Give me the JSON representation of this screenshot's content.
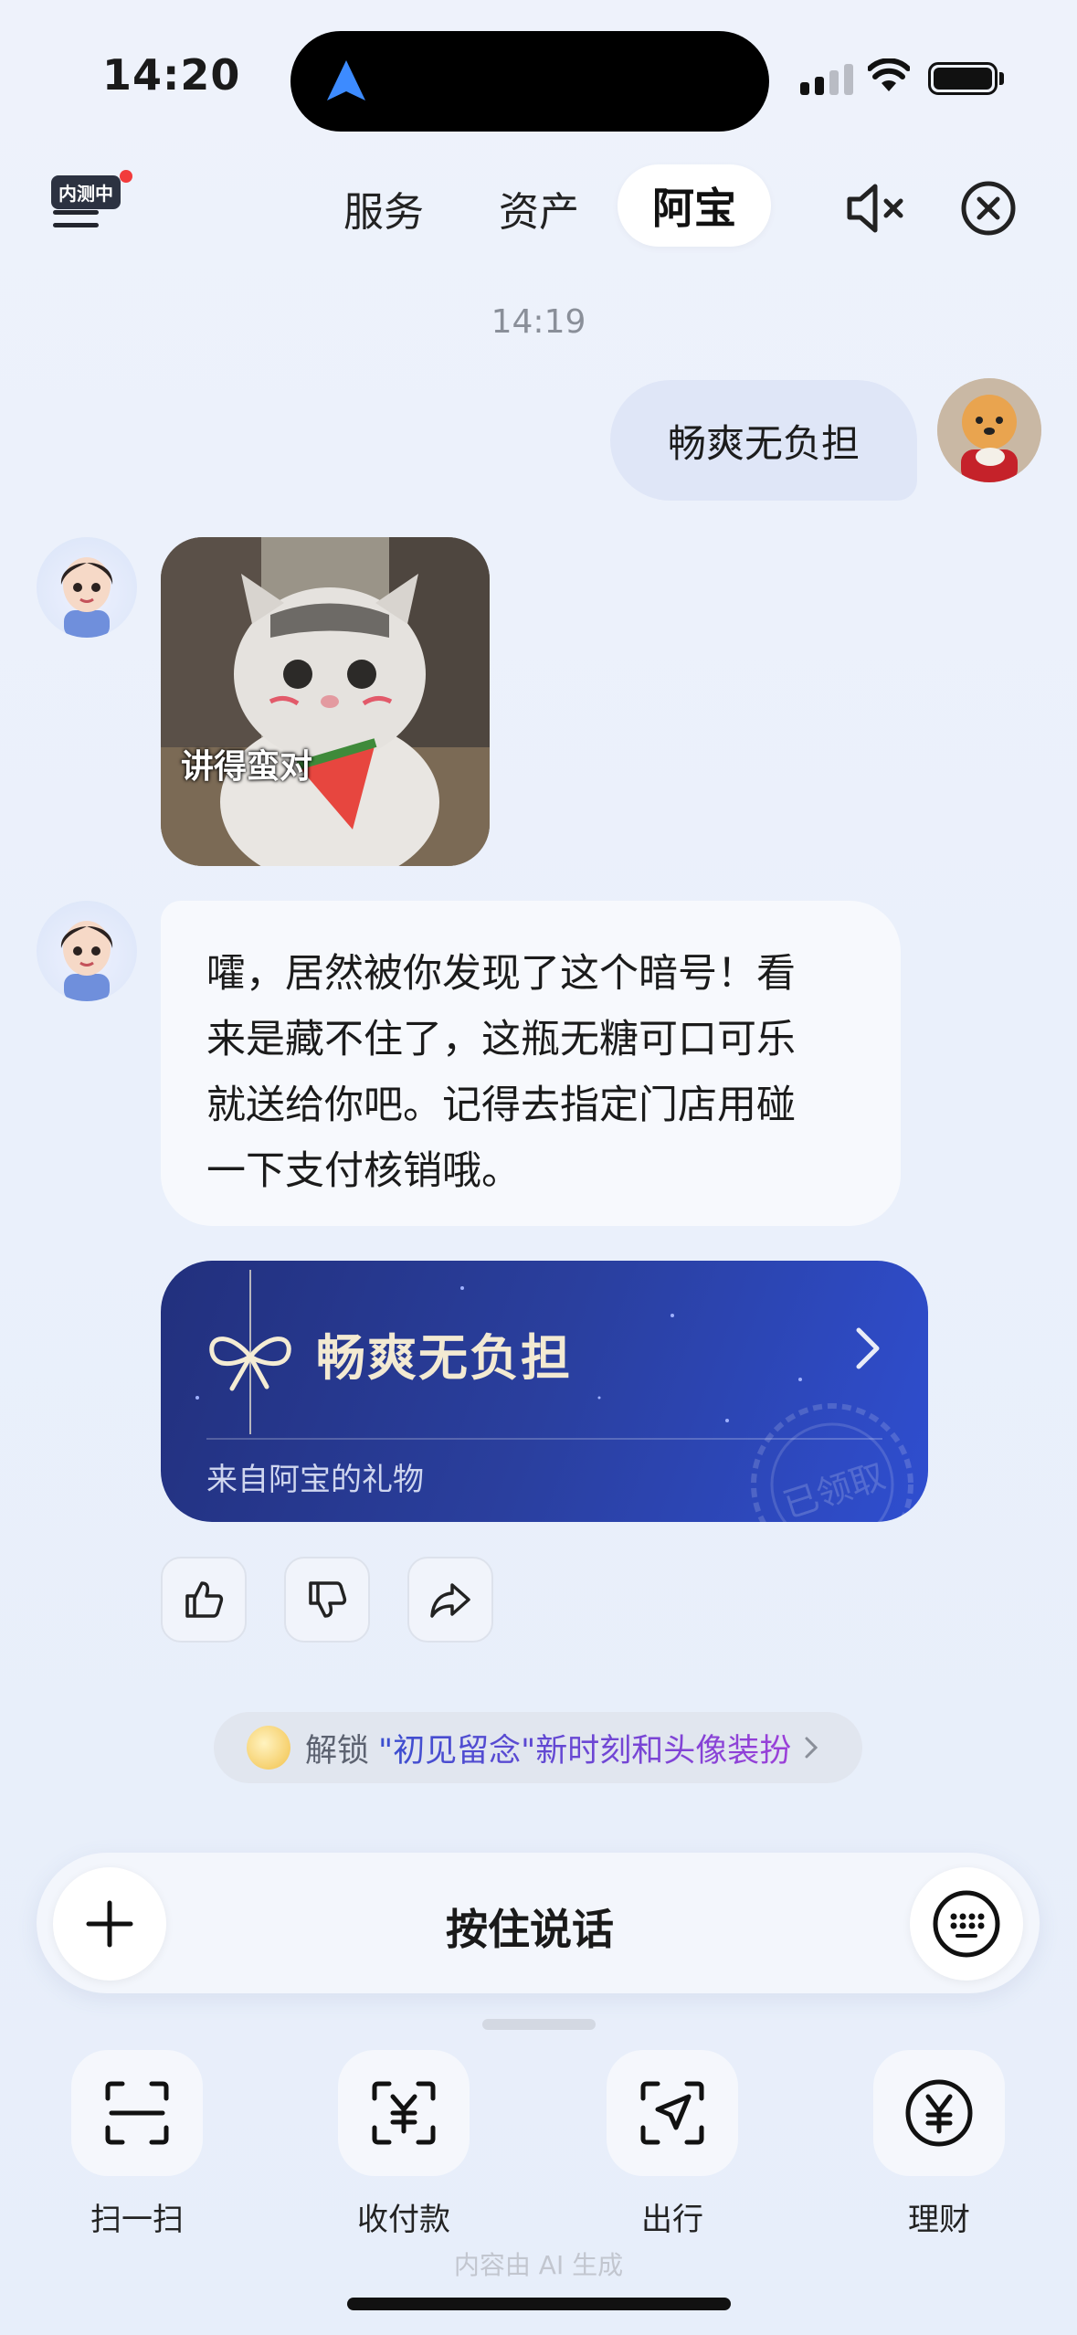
{
  "status_bar": {
    "time": "14:20"
  },
  "header": {
    "beta_badge": "内测中",
    "tabs": [
      "服务",
      "资产",
      "阿宝"
    ],
    "active_tab": "阿宝"
  },
  "chat": {
    "timestamp": "14:19",
    "user_message": "畅爽无负担",
    "sticker_caption": "讲得蛮对",
    "ai_message_lines": [
      "嚯，居然被你发现了这个暗号！看",
      "来是藏不住了，这瓶无糖可口可乐",
      "就送给你吧。记得去指定门店用碰",
      "一下支付核销哦。"
    ],
    "gift_card": {
      "title": "畅爽无负担",
      "subtitle": "来自阿宝的礼物",
      "stamp": "已领取"
    },
    "unlock_banner": {
      "prefix": "解锁",
      "highlight": "\"初见留念\"新时刻和头像装扮"
    }
  },
  "input": {
    "hold_to_talk": "按住说话"
  },
  "quick_actions": [
    {
      "label": "扫一扫",
      "icon": "scan-icon"
    },
    {
      "label": "收付款",
      "icon": "payment-icon"
    },
    {
      "label": "出行",
      "icon": "travel-icon"
    },
    {
      "label": "理财",
      "icon": "finance-icon"
    }
  ],
  "footer_note": "内容由 AI 生成",
  "colors": {
    "gift_card": "#2a3f9e",
    "active_tab_bg": "#ffffff",
    "user_bubble": "#dfe6f7"
  }
}
